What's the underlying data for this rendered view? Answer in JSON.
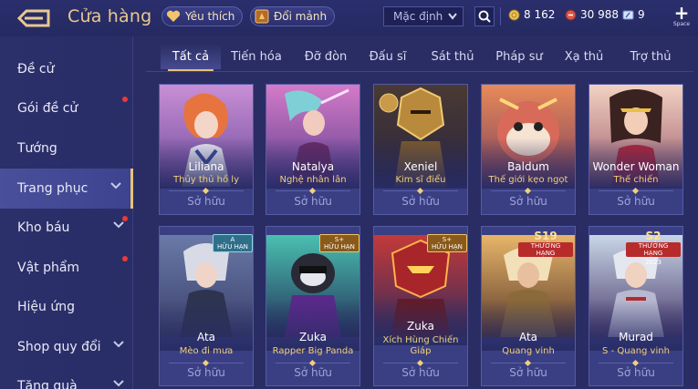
{
  "header": {
    "title": "Cửa hàng",
    "favorites_label": "Yêu thích",
    "exchange_label": "Đổi mảnh",
    "sort_value": "Mặc định",
    "gold": "8 162",
    "coupons": "30 988",
    "vouchers": "9",
    "space_label": "Space"
  },
  "sidebar": {
    "items": [
      {
        "label": "Đề cử"
      },
      {
        "label": "Gói đề cử"
      },
      {
        "label": "Tướng"
      },
      {
        "label": "Trang phục"
      },
      {
        "label": "Kho báu"
      },
      {
        "label": "Vật phẩm"
      },
      {
        "label": "Hiệu ứng"
      },
      {
        "label": "Shop quy đổi"
      },
      {
        "label": "Tặng quà"
      }
    ]
  },
  "tabs": [
    {
      "label": "Tất cả"
    },
    {
      "label": "Tiến hóa"
    },
    {
      "label": "Đỡ đòn"
    },
    {
      "label": "Đấu sĩ"
    },
    {
      "label": "Sát thủ"
    },
    {
      "label": "Pháp sư"
    },
    {
      "label": "Xạ thủ"
    },
    {
      "label": "Trợ thủ"
    }
  ],
  "cards": [
    {
      "hero": "Liliana",
      "skin": "Thủy thủ hồ ly",
      "status": "Sở hữu"
    },
    {
      "hero": "Natalya",
      "skin": "Nghệ nhân lân",
      "status": "Sở hữu"
    },
    {
      "hero": "Xeniel",
      "skin": "Kim sĩ điểu",
      "status": "Sở hữu"
    },
    {
      "hero": "Baldum",
      "skin": "Thế giới kẹo ngọt",
      "status": "Sở hữu"
    },
    {
      "hero": "Wonder Woman",
      "skin": "Thế chiến",
      "status": "Sở hữu"
    },
    {
      "hero": "Ata",
      "skin": "Mèo đi mưa",
      "status": "Sở hữu",
      "badge_grade": "A",
      "badge_text": "HỮU HẠN"
    },
    {
      "hero": "Zuka",
      "skin": "Rapper Big Panda",
      "status": "Sở hữu",
      "badge_grade": "S+",
      "badge_text": "HỮU HẠN"
    },
    {
      "hero": "Zuka",
      "skin": "Xích Hùng Chiến Giáp",
      "status": "Sở hữu",
      "badge_grade": "S+",
      "badge_text": "HỮU HẠN"
    },
    {
      "hero": "Ata",
      "skin": "Quang vinh",
      "status": "Sở hữu",
      "rank_big": "S19",
      "rank_small": "THƯỞNG HẠNG"
    },
    {
      "hero": "Murad",
      "skin": "S - Quang vinh",
      "status": "Sở hữu",
      "rank_big": "S2",
      "rank_small": "THƯỞNG HẠNG",
      "rank_year": "2023"
    }
  ],
  "colors": {
    "accent_gold": "#e7c27a",
    "skin_name": "#f1cf7d",
    "notification_dot": "#e83a3a"
  }
}
